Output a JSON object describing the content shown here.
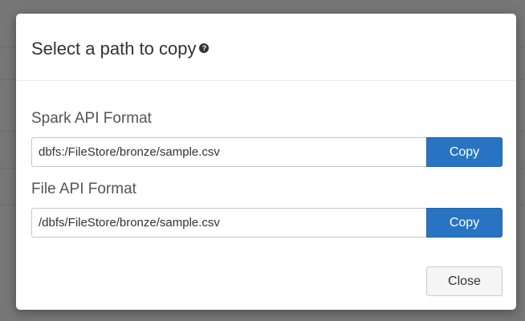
{
  "dialog": {
    "title": "Select a path to copy",
    "help_icon_glyph": "?",
    "spark": {
      "label": "Spark API Format",
      "value": "dbfs:/FileStore/bronze/sample.csv",
      "copy_label": "Copy"
    },
    "file": {
      "label": "File API Format",
      "value": "/dbfs/FileStore/bronze/sample.csv",
      "copy_label": "Copy"
    },
    "close_label": "Close"
  },
  "icons": {
    "help": "question-circle-icon"
  },
  "colors": {
    "backdrop": "#767676",
    "primary_button": "#2874c2",
    "close_button_bg": "#f5f5f5",
    "title_text": "#333333"
  }
}
